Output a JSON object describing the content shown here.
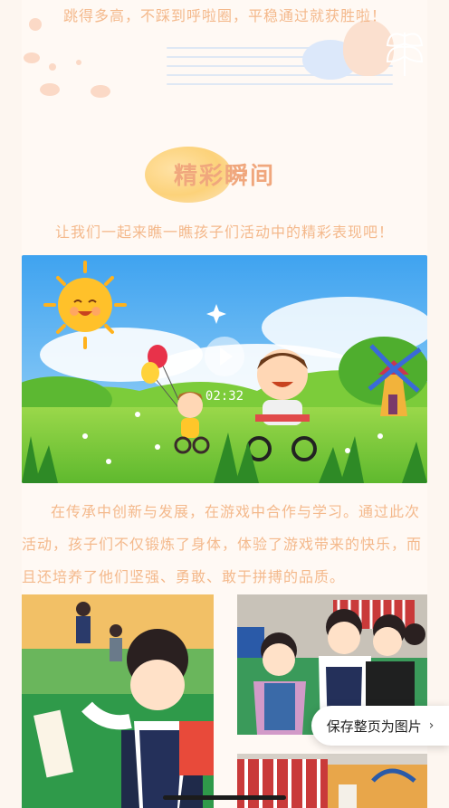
{
  "article": {
    "intro_tail": "跳得多高，不踩到呼啦圈，平稳通过就获胜啦！",
    "section_title": "精彩瞬间",
    "section_subtitle": "让我们一起来瞧一瞧孩子们活动中的精彩表现吧！",
    "body": "在传承中创新与发展，在游戏中合作与学习。通过此次活动，孩子们不仅锻炼了身体，体验了游戏带来的快乐，而且还培养了他们坚强、勇敢、敢于拼搏的品质。"
  },
  "video": {
    "duration": "02:32",
    "play_icon": "play-icon"
  },
  "save_page": {
    "label": "保存整页为图片",
    "icon": "chevron-right-icon"
  },
  "colors": {
    "accent_text": "#f4b98c",
    "title": "#f0a77d",
    "background": "#fdf6f0"
  }
}
